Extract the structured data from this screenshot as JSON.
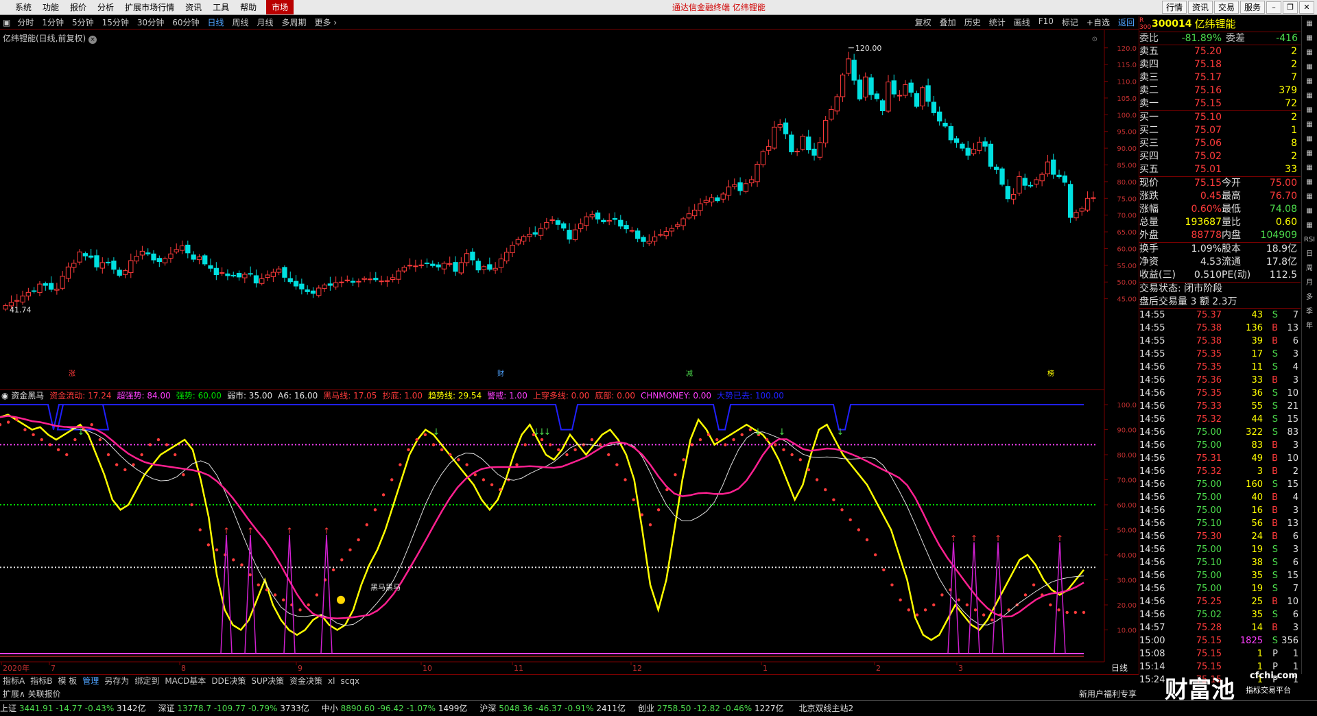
{
  "menu": {
    "items": [
      "系统",
      "功能",
      "报价",
      "分析",
      "扩展市场行情",
      "资讯",
      "工具",
      "帮助"
    ],
    "market": "市场",
    "center_title": "通达信金融终端  亿纬锂能",
    "right_buttons": [
      "行情",
      "资讯",
      "交易",
      "服务"
    ]
  },
  "toolbar": {
    "periods": [
      "分时",
      "1分钟",
      "5分钟",
      "15分钟",
      "30分钟",
      "60分钟",
      "日线",
      "周线",
      "月线",
      "多周期",
      "更多 ›"
    ],
    "active": "日线",
    "right": [
      "复权",
      "叠加",
      "历史",
      "统计",
      "画线",
      "F10",
      "标记",
      "+自选"
    ],
    "return": "返回"
  },
  "stock": {
    "title": "亿纬锂能(日线,前复权)",
    "code": "300014",
    "name": "亿纬锂能"
  },
  "colors": {
    "up": "#ff3b3b",
    "down": "#00e0e0",
    "accent": "#4fa3ff"
  },
  "chart_data": [
    {
      "type": "candlestick",
      "title": "亿纬锂能(日线,前复权)",
      "ylim": [
        40,
        122
      ],
      "yticks": [
        "120.0",
        "115.0",
        "110.0",
        "105.0",
        "100.0",
        "95.00",
        "90.00",
        "85.00",
        "80.00",
        "75.00",
        "70.00",
        "65.00",
        "60.00",
        "55.00",
        "50.00",
        "45.00"
      ],
      "high_label": "120.00",
      "low_label": "41.74",
      "markers": [
        "涨",
        "财",
        "减",
        "榜"
      ],
      "close": [
        43.0,
        43.9,
        44.5,
        45.8,
        46.9,
        47.2,
        49.4,
        49.0,
        47.8,
        47.9,
        51.7,
        54.5,
        55.6,
        59.0,
        57.8,
        57.4,
        54.5,
        55.8,
        55.7,
        53.8,
        52.0,
        53.4,
        56.4,
        57.7,
        59.2,
        58.4,
        56.6,
        56.1,
        57.0,
        58.4,
        59.7,
        60.8,
        58.7,
        56.8,
        57.5,
        55.4,
        54.1,
        52.2,
        52.8,
        51.9,
        52.0,
        51.5,
        52.3,
        52.5,
        49.7,
        51.0,
        52.1,
        52.9,
        53.9,
        51.4,
        50.1,
        48.8,
        47.9,
        47.1,
        46.6,
        48.2,
        49.1,
        49.0,
        49.8,
        50.0,
        50.6,
        49.9,
        50.2,
        51.1,
        50.9,
        50.7,
        50.3,
        50.4,
        51.3,
        53.3,
        54.4,
        55.0,
        54.8,
        55.1,
        55.6,
        54.9,
        54.5,
        55.6,
        55.5,
        53.2,
        55.8,
        58.5,
        56.6,
        53.6,
        54.6,
        53.8,
        54.1,
        56.9,
        58.9,
        61.0,
        62.7,
        63.6,
        64.3,
        64.3,
        66.0,
        67.8,
        68.6,
        67.2,
        66.1,
        62.8,
        65.6,
        67.4,
        69.5,
        70.2,
        68.8,
        68.0,
        68.4,
        68.7,
        66.7,
        65.9,
        65.4,
        63.0,
        62.1,
        62.2,
        63.5,
        64.2,
        65.1,
        66.0,
        67.1,
        68.9,
        70.4,
        71.5,
        73.4,
        74.4,
        75.2,
        74.3,
        76.3,
        78.4,
        79.1,
        77.3,
        79.4,
        80.6,
        85.2,
        89.0,
        90.5,
        96.3,
        97.1,
        94.3,
        88.9,
        89.1,
        93.6,
        89.5,
        87.9,
        91.7,
        98.3,
        101.6,
        105.4,
        111.9,
        116.7,
        110.3,
        104.7,
        111.3,
        106.0,
        104.8,
        101.2,
        109.8,
        106.2,
        105.8,
        109.0,
        106.7,
        102.5,
        108.1,
        104.0,
        100.6,
        98.1,
        96.6,
        92.5,
        91.7,
        90.0,
        87.9,
        89.7,
        91.8,
        90.6,
        84.6,
        83.6,
        79.2,
        74.9,
        76.2,
        81.5,
        78.9,
        78.8,
        80.6,
        82.2,
        85.9,
        82.2,
        81.5,
        79.8,
        69.3,
        70.8,
        72.0,
        75.0,
        75.2
      ]
    },
    {
      "type": "line",
      "title": "资金黑马",
      "ylim": [
        0,
        100
      ],
      "yticks": [
        "100.0",
        "90.00",
        "80.00",
        "70.00",
        "60.00",
        "50.00",
        "40.00",
        "30.00",
        "20.00",
        "10.00"
      ],
      "indicators": [
        {
          "name": "资金流动",
          "value": "17.24",
          "color": "#ff3b3b"
        },
        {
          "name": "超强势",
          "value": "84.00",
          "color": "#ff40ff"
        },
        {
          "name": "强势",
          "value": "60.00",
          "color": "#00e000"
        },
        {
          "name": "弱市",
          "value": "35.00",
          "color": "#e0e0e0"
        },
        {
          "name": "A6",
          "value": "16.00",
          "color": "#e0e0e0"
        },
        {
          "name": "黑马线",
          "value": "17.05",
          "color": "#ff3b3b"
        },
        {
          "name": "抄底",
          "value": "1.00",
          "color": "#ff3b3b"
        },
        {
          "name": "趋势线",
          "value": "29.54",
          "color": "#ffff00"
        },
        {
          "name": "警戒",
          "value": "1.00",
          "color": "#ff40ff"
        },
        {
          "name": "上穿多线",
          "value": "0.00",
          "color": "#ff3b3b"
        },
        {
          "name": "底部",
          "value": "0.00",
          "color": "#ff3b3b"
        },
        {
          "name": "CHNMONEY",
          "value": "0.00",
          "color": "#ff40ff"
        },
        {
          "name": "大势已去",
          "value": "100.00",
          "color": "#2020ff"
        }
      ],
      "levels": [
        84,
        60,
        35
      ],
      "annotation": "黑马黑马",
      "series": [
        {
          "name": "趋势线",
          "color": "#ffff00",
          "values": [
            95,
            96,
            94,
            92,
            90,
            91,
            88,
            86,
            88,
            90,
            92,
            88,
            80,
            72,
            62,
            58,
            60,
            66,
            72,
            76,
            80,
            82,
            84,
            86,
            82,
            70,
            55,
            32,
            18,
            12,
            10,
            14,
            22,
            30,
            20,
            14,
            10,
            8,
            10,
            14,
            16,
            12,
            10,
            12,
            18,
            28,
            36,
            42,
            50,
            60,
            70,
            80,
            86,
            90,
            88,
            84,
            80,
            76,
            72,
            68,
            62,
            58,
            62,
            70,
            80,
            88,
            92,
            86,
            80,
            78,
            82,
            88,
            84,
            80,
            84,
            88,
            90,
            86,
            80,
            70,
            50,
            28,
            18,
            30,
            50,
            70,
            86,
            94,
            90,
            84,
            86,
            88,
            90,
            92,
            90,
            88,
            84,
            78,
            70,
            62,
            68,
            80,
            90,
            92,
            86,
            80,
            76,
            72,
            68,
            62,
            56,
            50,
            40,
            30,
            15,
            8,
            6,
            8,
            14,
            20,
            16,
            12,
            10,
            14,
            20,
            26,
            32,
            38,
            40,
            36,
            30,
            26,
            24,
            26,
            30,
            34
          ]
        },
        {
          "name": "资金流动",
          "color": "#ff3b3b",
          "values": [
            92,
            93,
            94,
            90,
            88,
            86,
            84,
            82,
            80,
            86,
            90,
            92,
            86,
            80,
            76,
            74,
            76,
            80,
            84,
            86,
            84,
            80,
            72,
            60,
            50,
            44,
            42,
            40,
            38,
            36,
            32,
            28,
            26,
            24,
            22,
            20,
            18,
            20,
            24,
            30,
            34,
            38,
            42,
            46,
            52,
            58,
            64,
            70,
            76,
            82,
            86,
            88,
            84,
            82,
            80,
            78,
            76,
            72,
            70,
            68,
            66,
            70,
            76,
            84,
            88,
            86,
            84,
            82,
            80,
            82,
            84,
            86,
            84,
            80,
            76,
            70,
            62,
            56,
            52,
            58,
            66,
            72,
            78,
            84,
            86,
            88,
            86,
            84,
            86,
            88,
            90,
            88,
            86,
            84,
            82,
            80,
            78,
            74,
            70,
            66,
            62,
            58,
            54,
            50,
            46,
            40,
            34,
            28,
            22,
            18,
            16,
            18,
            20,
            24,
            26,
            22,
            20,
            18,
            16,
            14,
            16,
            18,
            20,
            24,
            28,
            24,
            20,
            18,
            17,
            17,
            17
          ]
        }
      ]
    }
  ],
  "quote": {
    "weibi_label": "委比",
    "weibi": "-81.89%",
    "weicha_label": "委差",
    "weicha": "-416",
    "sells": [
      {
        "label": "卖五",
        "price": "75.20",
        "vol": "2"
      },
      {
        "label": "卖四",
        "price": "75.18",
        "vol": "2"
      },
      {
        "label": "卖三",
        "price": "75.17",
        "vol": "7"
      },
      {
        "label": "卖二",
        "price": "75.16",
        "vol": "379"
      },
      {
        "label": "卖一",
        "price": "75.15",
        "vol": "72"
      }
    ],
    "buys": [
      {
        "label": "买一",
        "price": "75.10",
        "vol": "2"
      },
      {
        "label": "买二",
        "price": "75.07",
        "vol": "1"
      },
      {
        "label": "买三",
        "price": "75.06",
        "vol": "8"
      },
      {
        "label": "买四",
        "price": "75.02",
        "vol": "2"
      },
      {
        "label": "买五",
        "price": "75.01",
        "vol": "33"
      }
    ],
    "stats": [
      [
        "现价",
        "75.15",
        "今开",
        "75.00"
      ],
      [
        "涨跌",
        "0.45",
        "最高",
        "76.70"
      ],
      [
        "涨幅",
        "0.60%",
        "最低",
        "74.08"
      ],
      [
        "总量",
        "193687",
        "量比",
        "0.60"
      ],
      [
        "外盘",
        "88778",
        "内盘",
        "104909"
      ]
    ],
    "stats2": [
      [
        "换手",
        "1.09%",
        "股本",
        "18.9亿"
      ],
      [
        "净资",
        "4.53",
        "流通",
        "17.8亿"
      ],
      [
        "收益(三)",
        "0.510",
        "PE(动)",
        "112.5"
      ]
    ],
    "trade_status": "交易状态: 闭市阶段",
    "after_hours": "盘后交易量 3 额 2.3万"
  },
  "ticks": [
    [
      "14:55",
      "75.37",
      "43",
      "S",
      "7"
    ],
    [
      "14:55",
      "75.38",
      "136",
      "B",
      "13"
    ],
    [
      "14:55",
      "75.38",
      "39",
      "B",
      "6"
    ],
    [
      "14:55",
      "75.35",
      "17",
      "S",
      "3"
    ],
    [
      "14:56",
      "75.35",
      "11",
      "S",
      "4"
    ],
    [
      "14:56",
      "75.36",
      "33",
      "B",
      "3"
    ],
    [
      "14:56",
      "75.35",
      "36",
      "S",
      "10"
    ],
    [
      "14:56",
      "75.33",
      "55",
      "S",
      "21"
    ],
    [
      "14:56",
      "75.32",
      "44",
      "S",
      "15"
    ],
    [
      "14:56",
      "75.00",
      "322",
      "S",
      "83"
    ],
    [
      "14:56",
      "75.00",
      "83",
      "B",
      "3"
    ],
    [
      "14:56",
      "75.31",
      "49",
      "B",
      "10"
    ],
    [
      "14:56",
      "75.32",
      "3",
      "B",
      "2"
    ],
    [
      "14:56",
      "75.00",
      "160",
      "S",
      "15"
    ],
    [
      "14:56",
      "75.00",
      "40",
      "B",
      "4"
    ],
    [
      "14:56",
      "75.00",
      "16",
      "B",
      "3"
    ],
    [
      "14:56",
      "75.10",
      "56",
      "B",
      "13"
    ],
    [
      "14:56",
      "75.30",
      "24",
      "B",
      "6"
    ],
    [
      "14:56",
      "75.00",
      "19",
      "S",
      "3"
    ],
    [
      "14:56",
      "75.10",
      "38",
      "S",
      "6"
    ],
    [
      "14:56",
      "75.00",
      "35",
      "S",
      "15"
    ],
    [
      "14:56",
      "75.00",
      "19",
      "S",
      "7"
    ],
    [
      "14:56",
      "75.25",
      "25",
      "B",
      "10"
    ],
    [
      "14:56",
      "75.02",
      "35",
      "S",
      "6"
    ],
    [
      "14:57",
      "75.28",
      "14",
      "B",
      "3"
    ],
    [
      "15:00",
      "75.15",
      "1825",
      "S",
      "356"
    ],
    [
      "15:08",
      "75.15",
      "1",
      "P",
      "1"
    ],
    [
      "15:14",
      "75.15",
      "1",
      "P",
      "1"
    ],
    [
      "15:24",
      "75.15",
      "1",
      "P",
      "1"
    ]
  ],
  "xaxis": {
    "labels": [
      "2020年",
      "7",
      "8",
      "9",
      "10",
      "11",
      "12",
      "1",
      "2",
      "3"
    ],
    "period": "日线"
  },
  "bottom_tabs": {
    "items": [
      "指标A",
      "指标B",
      "模 板",
      "管理",
      "另存为",
      "绑定到",
      "MACD基本",
      "DDE决策",
      "SUP决策",
      "资金决策",
      "xl",
      "scqx"
    ],
    "active": "管理"
  },
  "ext": {
    "left": "扩展∧  关联报价",
    "promo": "新用户福利专享"
  },
  "status": {
    "indices": [
      {
        "name": "上证",
        "value": "3441.91",
        "chg": "-14.77",
        "pct": "-0.43%",
        "amt": "3142亿"
      },
      {
        "name": "深证",
        "value": "13778.7",
        "chg": "-109.77",
        "pct": "-0.79%",
        "amt": "3733亿"
      },
      {
        "name": "中小",
        "value": "8890.60",
        "chg": "-96.42",
        "pct": "-1.07%",
        "amt": "1499亿"
      },
      {
        "name": "沪深",
        "value": "5048.36",
        "chg": "-46.37",
        "pct": "-0.91%",
        "amt": "2411亿"
      },
      {
        "name": "创业",
        "value": "2758.50",
        "chg": "-12.82",
        "pct": "-0.46%",
        "amt": "1227亿"
      }
    ],
    "server": "北京双线主站2"
  },
  "logo": {
    "brand": "财富池",
    "site": "cfchi.com",
    "sub": "指标交易平台"
  },
  "side_icons": [
    "RSI",
    "日",
    "周",
    "月",
    "多",
    "季",
    "年"
  ]
}
